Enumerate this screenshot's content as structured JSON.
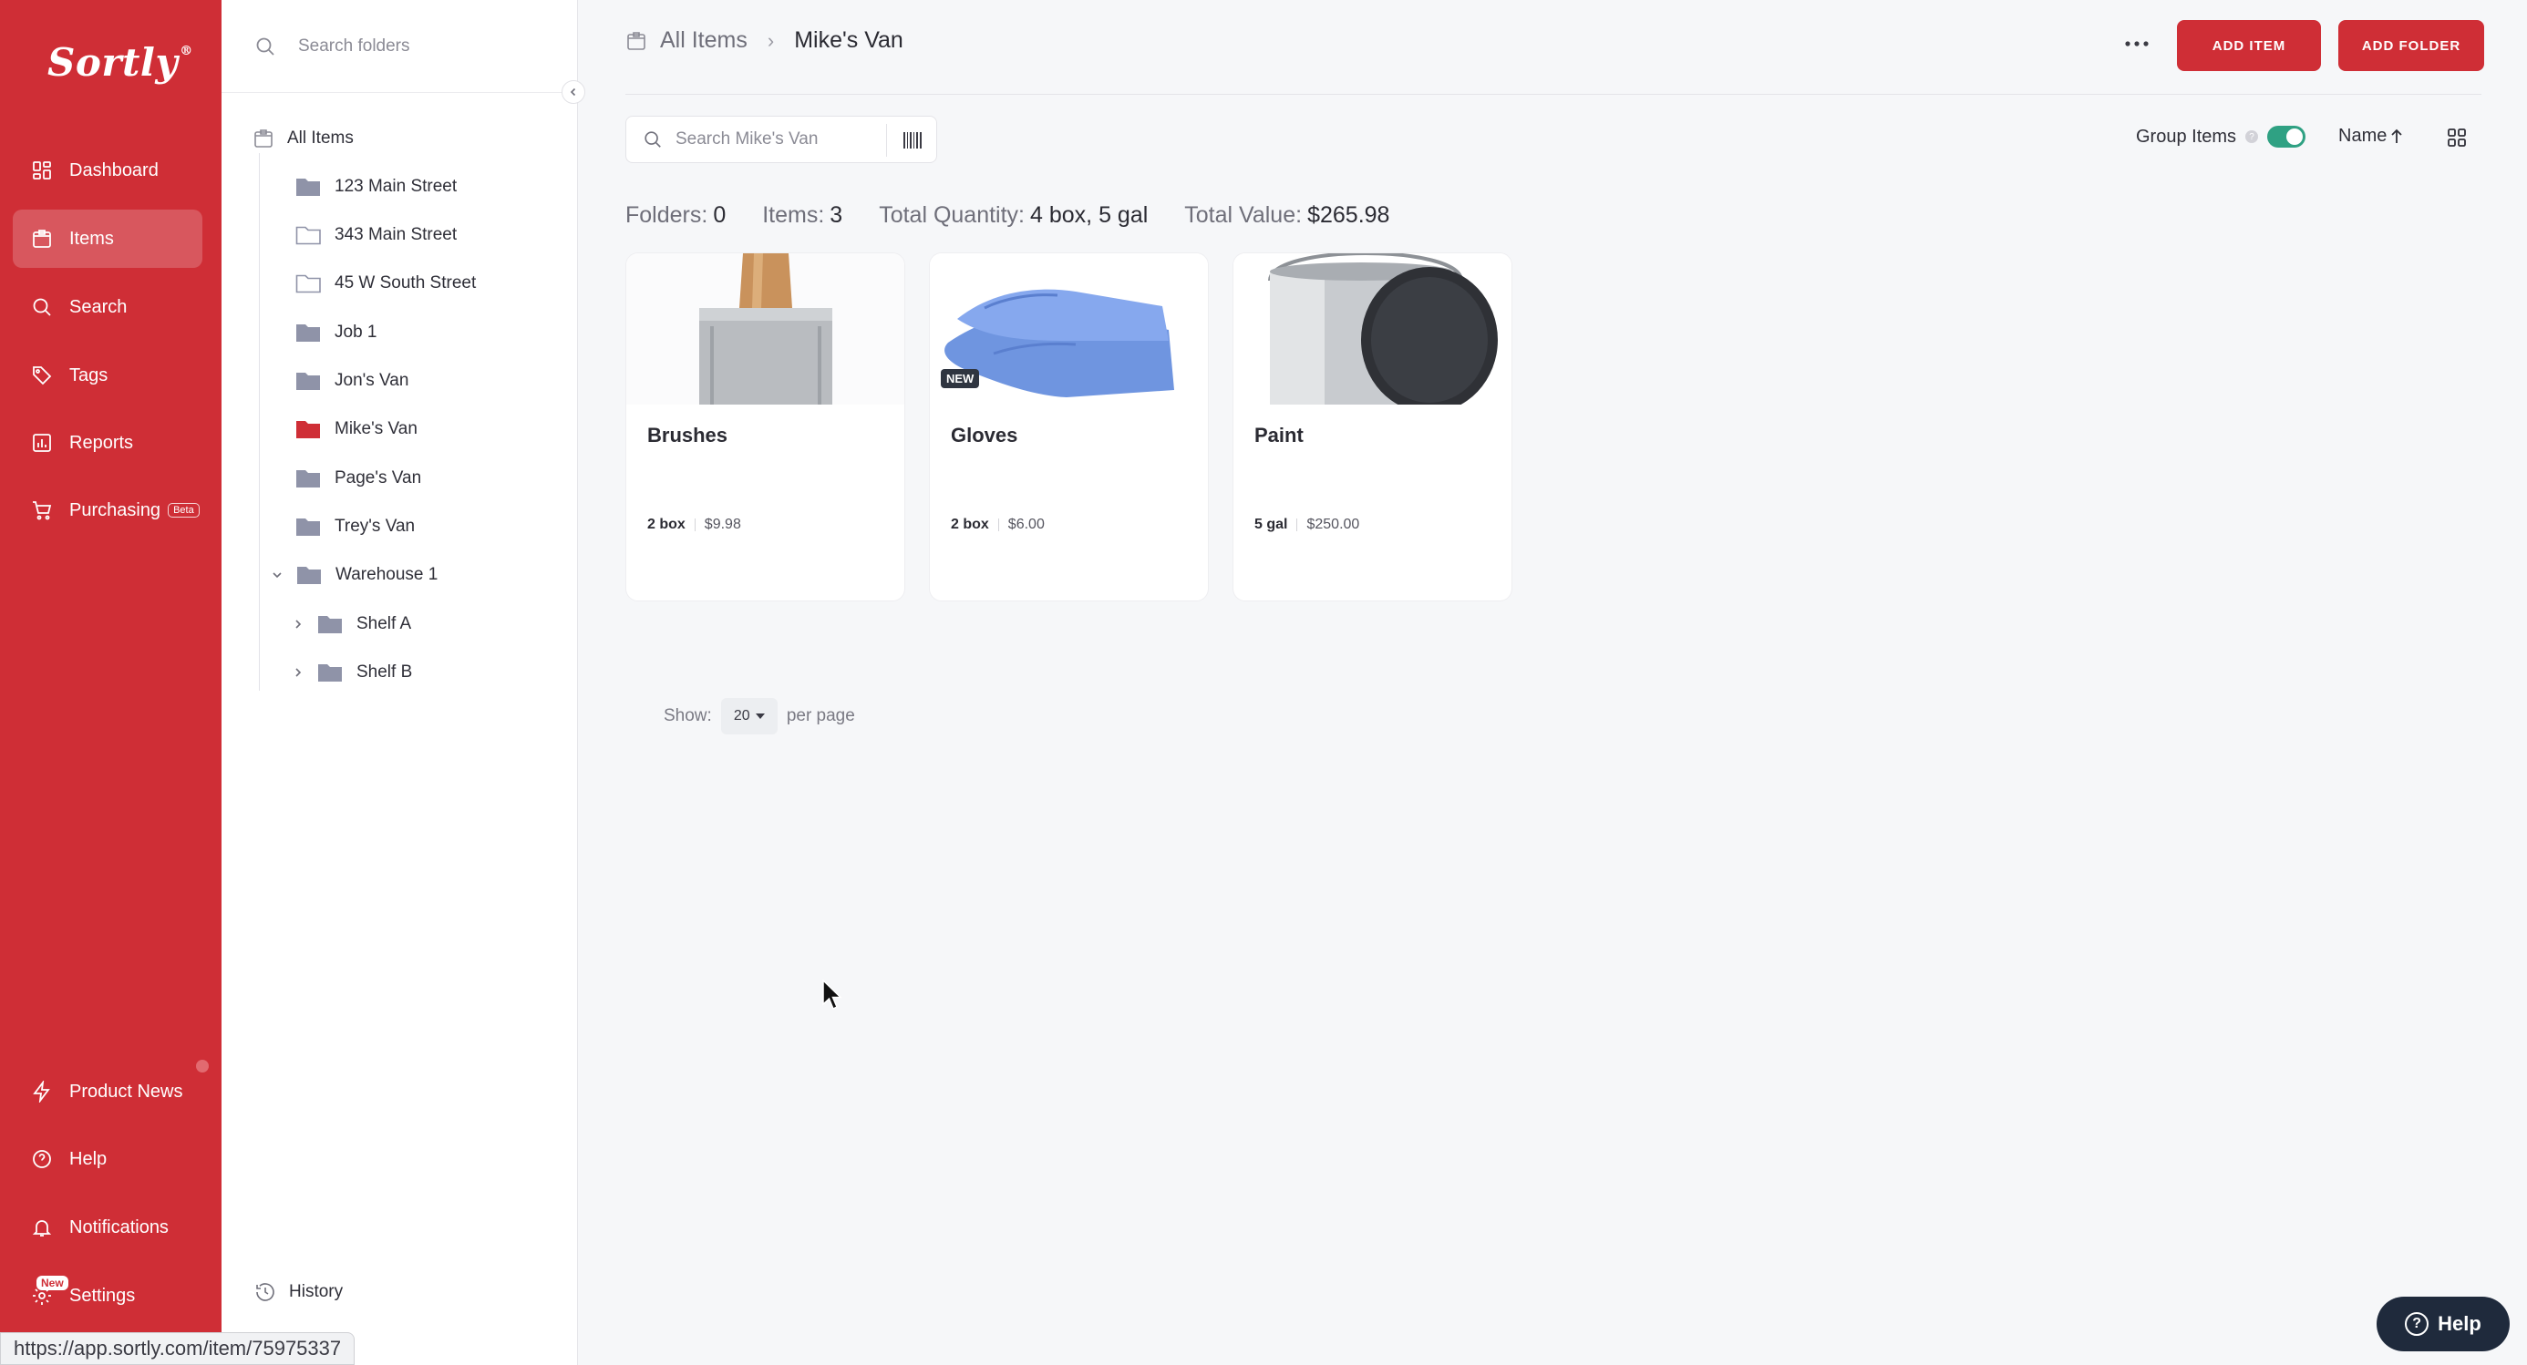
{
  "brand": {
    "name": "Sortly",
    "mark": "®",
    "accent": "#cf2e36"
  },
  "nav": {
    "items": [
      {
        "label": "Dashboard",
        "icon": "dashboard-icon"
      },
      {
        "label": "Items",
        "icon": "items-icon",
        "active": true
      },
      {
        "label": "Search",
        "icon": "search-icon"
      },
      {
        "label": "Tags",
        "icon": "tag-icon"
      },
      {
        "label": "Reports",
        "icon": "reports-icon"
      },
      {
        "label": "Purchasing",
        "icon": "cart-icon",
        "badge": "Beta"
      }
    ],
    "bottom": [
      {
        "label": "Product News",
        "icon": "lightning-icon"
      },
      {
        "label": "Help",
        "icon": "help-icon"
      },
      {
        "label": "Notifications",
        "icon": "bell-icon"
      },
      {
        "label": "Settings",
        "icon": "gear-icon",
        "badge": "New"
      }
    ]
  },
  "folders": {
    "search_placeholder": "Search folders",
    "root": "All Items",
    "list": [
      "123 Main Street",
      "343 Main Street",
      "45 W South Street",
      "Job 1",
      "Jon's Van",
      "Mike's Van",
      "Page's Van",
      "Trey's Van",
      "Warehouse 1"
    ],
    "children": [
      "Shelf A",
      "Shelf B"
    ],
    "history": "History"
  },
  "header": {
    "crumb_root": "All Items",
    "crumb_current": "Mike's Van",
    "add_item": "ADD ITEM",
    "add_folder": "ADD FOLDER"
  },
  "toolbar": {
    "search_placeholder": "Search Mike's Van",
    "group_items": "Group Items",
    "group_enabled": true,
    "sort_label": "Name"
  },
  "stats": {
    "folders_label": "Folders:",
    "folders": "0",
    "items_label": "Items:",
    "items": "3",
    "quantity_label": "Total Quantity:",
    "quantity": "4 box, 5 gal",
    "value_label": "Total Value:",
    "value": "$265.98"
  },
  "items": [
    {
      "name": "Brushes",
      "qty": "2 box",
      "price": "$9.98"
    },
    {
      "name": "Gloves",
      "qty": "2 box",
      "price": "$6.00",
      "badge": "NEW"
    },
    {
      "name": "Paint",
      "qty": "5 gal",
      "price": "$250.00"
    }
  ],
  "pagination": {
    "show": "Show:",
    "value": "20",
    "suffix": "per page"
  },
  "help_button": "Help",
  "status_url": "https://app.sortly.com/item/75975337"
}
